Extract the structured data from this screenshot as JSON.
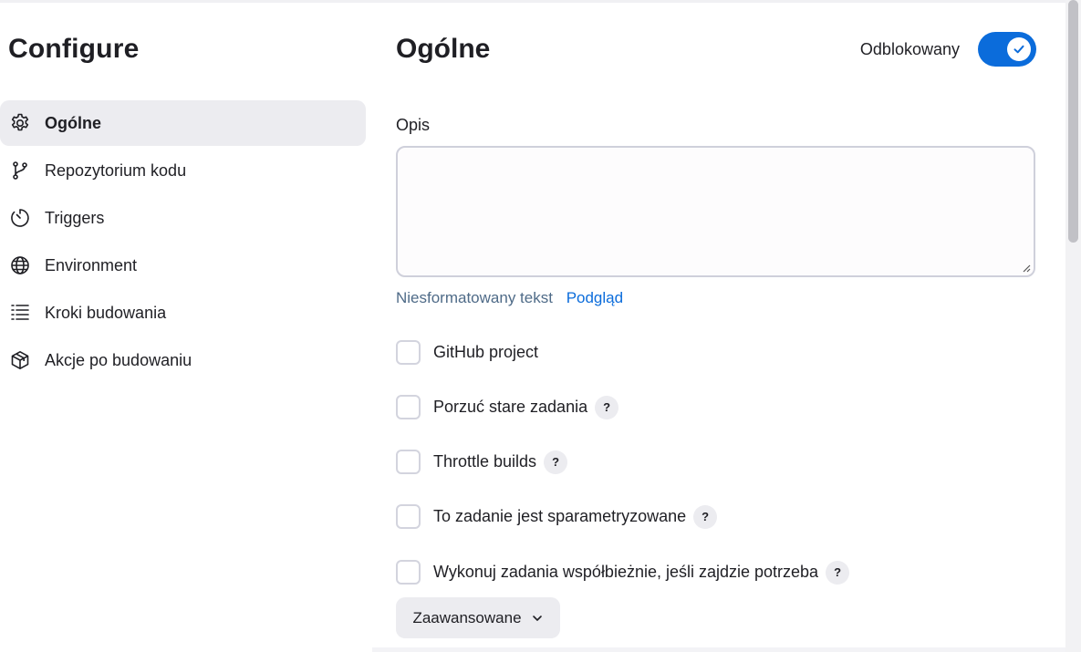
{
  "sidebar": {
    "title": "Configure",
    "items": [
      {
        "label": "Ogólne",
        "icon": "gear-icon",
        "active": true
      },
      {
        "label": "Repozytorium kodu",
        "icon": "branch-icon",
        "active": false
      },
      {
        "label": "Triggers",
        "icon": "timer-icon",
        "active": false
      },
      {
        "label": "Environment",
        "icon": "globe-icon",
        "active": false
      },
      {
        "label": "Kroki budowania",
        "icon": "list-icon",
        "active": false
      },
      {
        "label": "Akcje po budowaniu",
        "icon": "package-icon",
        "active": false
      }
    ]
  },
  "main": {
    "title": "Ogólne",
    "toggle": {
      "label": "Odblokowany",
      "state": "on"
    },
    "description": {
      "label": "Opis",
      "value": "",
      "format_plain": "Niesformatowany tekst",
      "format_preview": "Podgląd"
    },
    "options": [
      {
        "label": "GitHub project",
        "checked": false,
        "help": ""
      },
      {
        "label": "Porzuć stare zadania",
        "checked": false,
        "help": "?"
      },
      {
        "label": "Throttle builds",
        "checked": false,
        "help": "?"
      },
      {
        "label": "To zadanie jest sparametryzowane",
        "checked": false,
        "help": "?"
      },
      {
        "label": "Wykonuj zadania współbieżnie, jeśli zajdzie potrzeba",
        "checked": false,
        "help": "?"
      }
    ],
    "advanced_label": "Zaawansowane"
  },
  "colors": {
    "accent": "#0b6cdb",
    "active_bg": "#ececf0",
    "link": "#0b6cdb",
    "muted_text": "#4f6b88"
  }
}
